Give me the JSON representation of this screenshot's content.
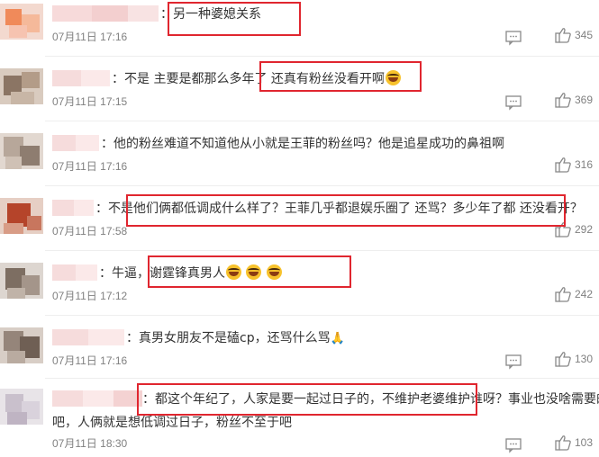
{
  "comments": [
    {
      "text": "：另一种婆媳关系",
      "time": "07月11日 17:16",
      "likes": "345"
    },
    {
      "text": "：不是 主要是都那么多年了 还真有粉丝没看开啊",
      "time": "07月11日 17:15",
      "likes": "369"
    },
    {
      "text": "：他的粉丝难道不知道他从小就是王菲的粉丝吗？他是追星成功的鼻祖啊",
      "time": "07月11日 17:16",
      "likes": "316"
    },
    {
      "text": "：不是他们俩都低调成什么样了？王菲几乎都退娱乐圈了 还骂？多少年了都 还没看开？",
      "time": "07月11日 17:58",
      "likes": "292"
    },
    {
      "text": "：牛逼，谢霆锋真男人",
      "time": "07月11日 17:12",
      "likes": "242"
    },
    {
      "text": "：真男女朋友不是磕cp，还骂什么骂",
      "time": "07月11日 17:16",
      "likes": "130"
    },
    {
      "text": "：都这个年纪了，人家是要一起过日子的，不维护老婆维护谁呀？事业也没啥需要的了",
      "text2": "吧，人俩就是想低调过日子，粉丝不至于吧",
      "time": "07月11日 18:30",
      "likes": "103"
    }
  ],
  "icons": {
    "reply": "comment-reply-icon",
    "like": "thumbs-up-icon",
    "emoji": "laughing-crying-emoji",
    "pray": "praying-hands-emoji"
  },
  "colors": {
    "highlight": "#e0262f",
    "meta": "#808080"
  }
}
